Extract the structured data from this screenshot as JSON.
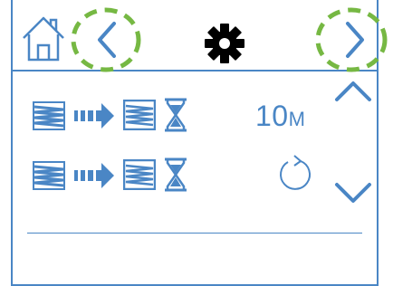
{
  "colors": {
    "accent": "#4a86c5",
    "highlight_ring": "#76b843",
    "settings_icon": "#000000"
  },
  "header": {
    "home_icon": "home-icon",
    "back_icon": "chevron-left-icon",
    "settings_icon": "gear-icon",
    "next_icon": "chevron-right-icon"
  },
  "rows": [
    {
      "icons": [
        "filter-icon",
        "arrow-right-icon",
        "filter-icon",
        "hourglass-icon"
      ],
      "value": "10",
      "unit": "M"
    },
    {
      "icons": [
        "filter-icon",
        "arrow-right-icon",
        "filter-icon",
        "hourglass-icon"
      ],
      "action_icon": "reset-icon"
    }
  ],
  "scroll": {
    "up_icon": "chevron-up-icon",
    "down_icon": "chevron-down-icon"
  }
}
